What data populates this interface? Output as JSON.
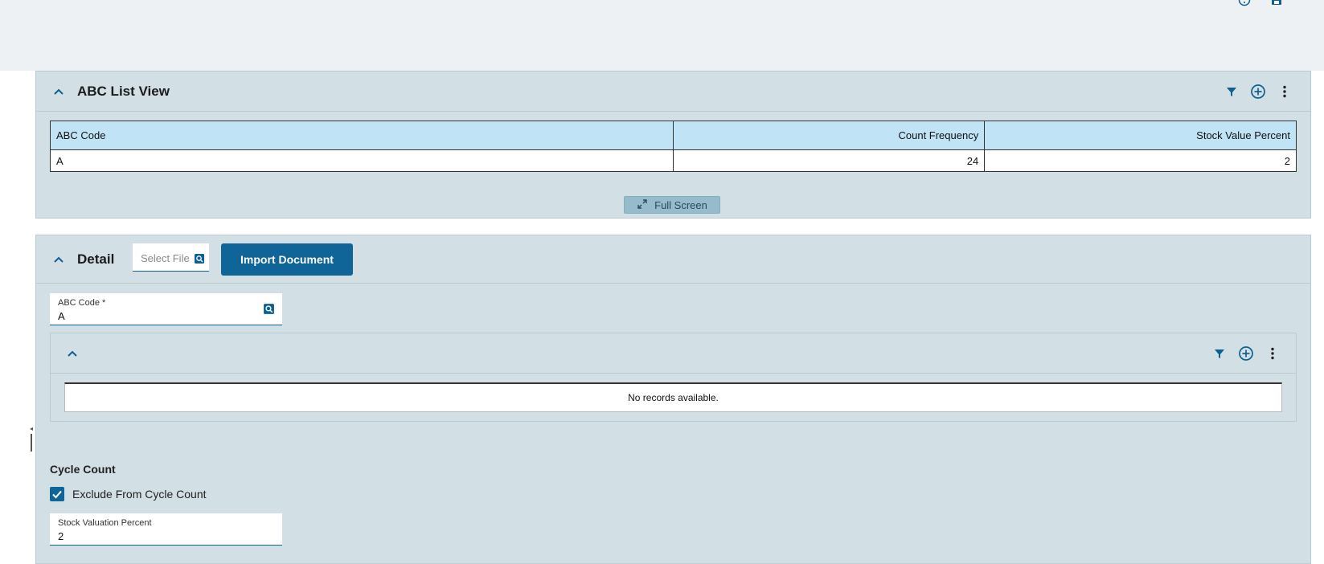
{
  "header": {
    "icons": [
      "help-icon",
      "save-icon"
    ]
  },
  "list_panel": {
    "title": "ABC List View",
    "tools": [
      "filter-icon",
      "add-icon",
      "more-icon"
    ],
    "columns": [
      "ABC Code",
      "Count Frequency",
      "Stock Value Percent"
    ],
    "rows": [
      {
        "abc_code": "A",
        "count_frequency": "24",
        "stock_value_percent": "2"
      }
    ],
    "fullscreen_label": "Full Screen"
  },
  "detail_panel": {
    "title": "Detail",
    "select_file_placeholder": "Select File",
    "import_label": "Import Document",
    "abc_code_field": {
      "label": "ABC Code *",
      "value": "A"
    },
    "sub_panel": {
      "tools": [
        "filter-icon",
        "add-icon",
        "more-icon"
      ],
      "empty_message": "No records available."
    },
    "cycle_count": {
      "section_title": "Cycle Count",
      "exclude_label": "Exclude From Cycle Count",
      "exclude_checked": true,
      "stock_valuation_field": {
        "label": "Stock Valuation Percent",
        "value": "2"
      }
    }
  },
  "colors": {
    "accent": "#0f6597",
    "panel_bg": "#d2dfe4",
    "header_cell_bg": "#c0e3f5"
  }
}
